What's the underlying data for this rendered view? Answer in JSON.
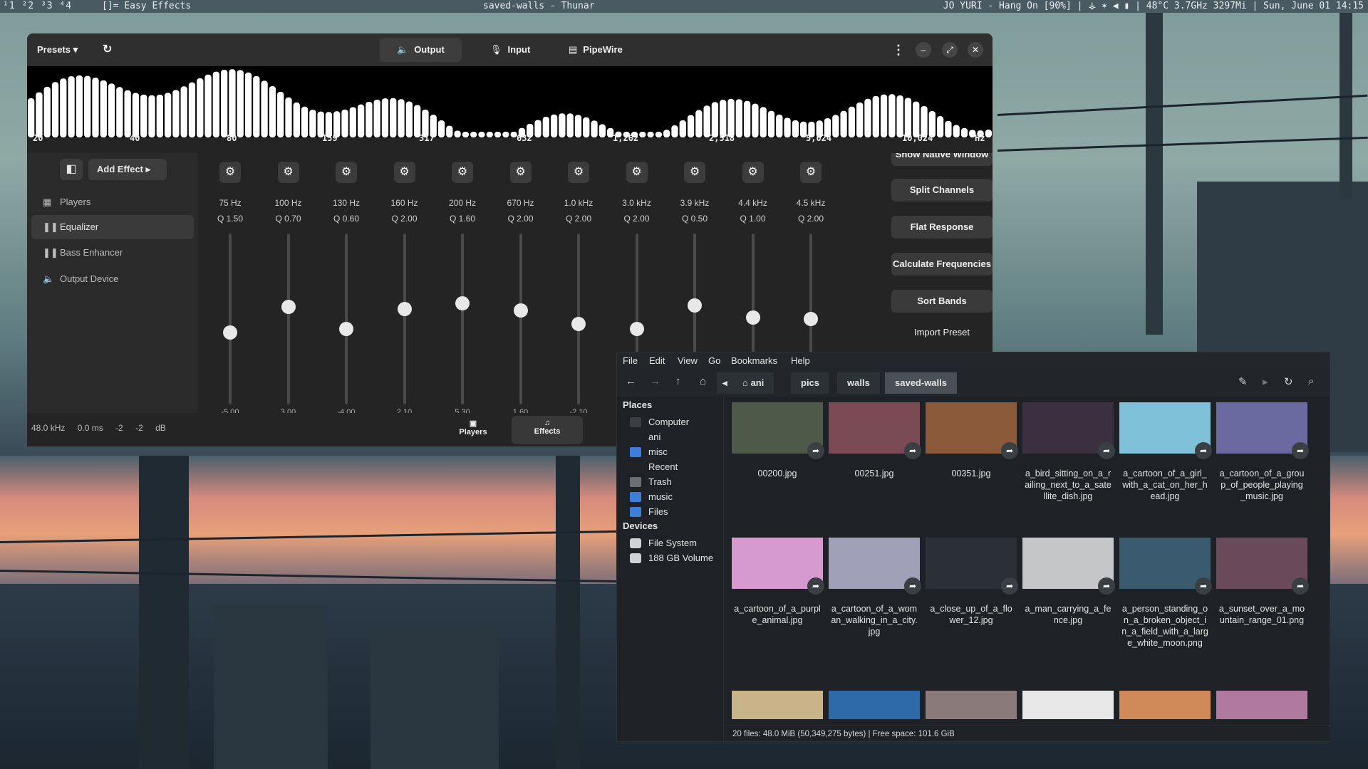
{
  "topbar": {
    "workspaces": "¹1 ²2 ³3 ⁴4",
    "layout": "[]=",
    "active_app": "Easy Effects",
    "window_title": "saved-walls - Thunar",
    "status": "JO YURI - Hang On [90%]  |  ⚶  ✶  ◀  ▮  |  48°C  3.7GHz  3297Mi  |  Sun, June 01 14:15"
  },
  "easyeffects": {
    "presets_label": "Presets",
    "tabs": [
      "Output",
      "Input",
      "PipeWire"
    ],
    "spectrum_freqs": [
      "20",
      "40",
      "80",
      "159",
      "317",
      "632",
      "1,262",
      "2,518",
      "5,024",
      "10,024",
      "Hz"
    ],
    "add_effect": "Add Effect",
    "sidebar_items": [
      "Players",
      "Equalizer",
      "Bass Enhancer",
      "Output Device"
    ],
    "bands": [
      {
        "num": "1",
        "freq": "75 Hz",
        "q": "Q 1.50",
        "gain": "-5.00",
        "level": 0.42
      },
      {
        "num": "2",
        "freq": "100 Hz",
        "q": "Q 0.70",
        "gain": "3.00",
        "level": 0.57
      },
      {
        "num": "3",
        "freq": "130 Hz",
        "q": "Q 0.60",
        "gain": "-4.00",
        "level": 0.44
      },
      {
        "num": "4",
        "freq": "160 Hz",
        "q": "Q 2.00",
        "gain": "2.10",
        "level": 0.56
      },
      {
        "num": "5",
        "freq": "200 Hz",
        "q": "Q 1.60",
        "gain": "5.30",
        "level": 0.59
      },
      {
        "num": "6",
        "freq": "670 Hz",
        "q": "Q 2.00",
        "gain": "1.60",
        "level": 0.55
      },
      {
        "num": "7",
        "freq": "1.0 kHz",
        "q": "Q 2.00",
        "gain": "-2.10",
        "level": 0.47
      },
      {
        "num": "8",
        "freq": "3.0 kHz",
        "q": "Q 2.00",
        "gain": "",
        "level": 0.44
      },
      {
        "num": "9",
        "freq": "3.9 kHz",
        "q": "Q 0.50",
        "gain": "",
        "level": 0.58
      },
      {
        "num": "10",
        "freq": "4.4 kHz",
        "q": "Q 1.00",
        "gain": "",
        "level": 0.51
      },
      {
        "num": "11",
        "freq": "4.5 kHz",
        "q": "Q 2.00",
        "gain": "",
        "level": 0.5
      }
    ],
    "right_buttons": [
      "Show Native Window",
      "Split Channels",
      "Flat Response",
      "Calculate Frequencies",
      "Sort Bands",
      "Import Preset"
    ],
    "footer_stats": [
      "48.0 kHz",
      "0.0 ms",
      "-2",
      "-2",
      "dB"
    ],
    "footer_tabs": [
      "Players",
      "Effects"
    ]
  },
  "thunar": {
    "menu": [
      "File",
      "Edit",
      "View",
      "Go",
      "Bookmarks",
      "Help"
    ],
    "breadcrumbs": [
      "ani",
      "pics",
      "walls",
      "saved-walls"
    ],
    "places_header": "Places",
    "places": [
      {
        "label": "Computer",
        "color": "#3b3f44"
      },
      {
        "label": "ani",
        "color": "none"
      },
      {
        "label": "misc",
        "color": "#3d7fd8"
      },
      {
        "label": "Recent",
        "color": "none"
      },
      {
        "label": "Trash",
        "color": "#6b6f72"
      },
      {
        "label": "music",
        "color": "#3d7fd8"
      },
      {
        "label": "Files",
        "color": "#3d7fd8"
      }
    ],
    "devices_header": "Devices",
    "devices": [
      "File System",
      "188 GB Volume"
    ],
    "files": [
      {
        "name": "00200.jpg",
        "color": "#4d5a4a"
      },
      {
        "name": "00251.jpg",
        "color": "#7a4a55"
      },
      {
        "name": "00351.jpg",
        "color": "#8a5a3a"
      },
      {
        "name": "a_bird_sitting_on_a_railing_next_to_a_satellite_dish.jpg",
        "color": "#3a3040"
      },
      {
        "name": "a_cartoon_of_a_girl_with_a_cat_on_her_head.jpg",
        "color": "#7fc1d8"
      },
      {
        "name": "a_cartoon_of_a_group_of_people_playing_music.jpg",
        "color": "#6a6aa0"
      },
      {
        "name": "a_cartoon_of_a_purple_animal.jpg",
        "color": "#d79ad0"
      },
      {
        "name": "a_cartoon_of_a_woman_walking_in_a_city.jpg",
        "color": "#a0a0b8"
      },
      {
        "name": "a_close_up_of_a_flower_12.jpg",
        "color": "#2a3035"
      },
      {
        "name": "a_man_carrying_a_fence.jpg",
        "color": "#c4c6c8"
      },
      {
        "name": "a_person_standing_on_a_broken_object_in_a_field_with_a_large_white_moon.png",
        "color": "#3a5a70"
      },
      {
        "name": "a_sunset_over_a_mountain_range_01.png",
        "color": "#6a4a5a"
      }
    ],
    "status": "20 files: 48.0 MiB (50,349,275 bytes)  |  Free space: 101.6 GiB"
  }
}
